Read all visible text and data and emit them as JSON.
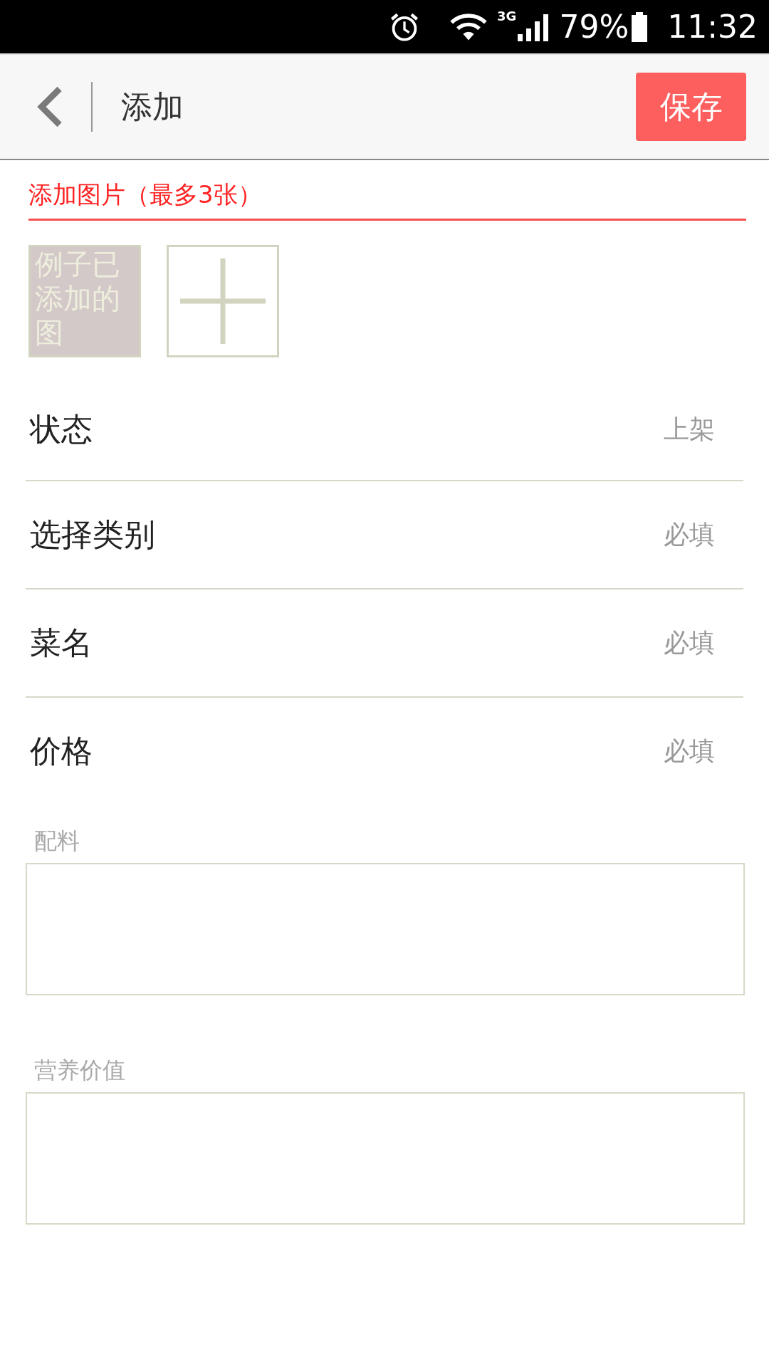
{
  "status_bar": {
    "network": "3G",
    "battery": "79%",
    "time": "11:32"
  },
  "header": {
    "title": "添加",
    "save_button": "保存"
  },
  "images": {
    "title": "添加图片（最多3张）",
    "items": [
      {
        "kind": "image",
        "text": "例子已添加的图"
      },
      {
        "kind": "add"
      }
    ]
  },
  "rows": [
    {
      "label": "状态",
      "value": "上架"
    },
    {
      "label": "选择类别",
      "placeholder": "必填"
    },
    {
      "label": "菜名",
      "placeholder": "必填"
    },
    {
      "label": "价格",
      "placeholder": "必填"
    }
  ],
  "text_areas": [
    {
      "label": "配料"
    },
    {
      "label": "营养价值"
    }
  ]
}
